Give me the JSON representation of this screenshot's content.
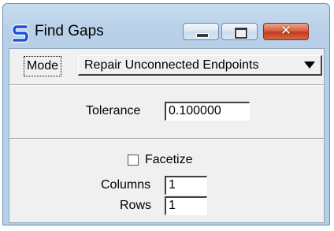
{
  "window": {
    "title": "Find Gaps",
    "close_glyph": "✕"
  },
  "icons": {
    "app": "find-gaps-s-icon",
    "minimize": "minimize-icon",
    "maximize": "maximize-icon",
    "close": "close-icon",
    "dropdown": "dropdown-arrow-icon"
  },
  "colors": {
    "app_icon_blue": "#1a4fd6",
    "close_button_red": "#c43a1c",
    "dialog_background": "#f0f0f0",
    "frame_blue": "#b9d1e8"
  },
  "mode": {
    "label": "Mode",
    "selected": "Repair Unconnected Endpoints"
  },
  "tolerance": {
    "label": "Tolerance",
    "value": "0.100000"
  },
  "facetize": {
    "label": "Facetize",
    "checked": false
  },
  "columns": {
    "label": "Columns",
    "value": "1"
  },
  "rows": {
    "label": "Rows",
    "value": "1"
  }
}
